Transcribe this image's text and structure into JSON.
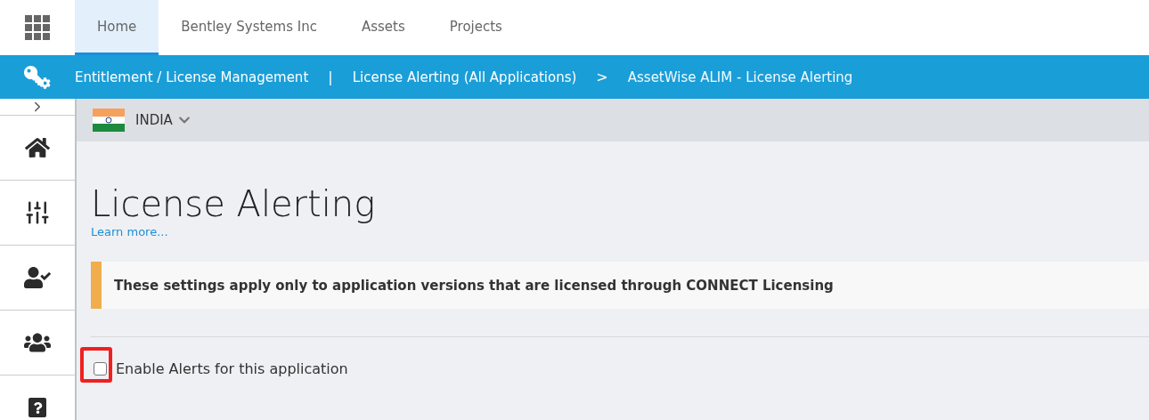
{
  "top_tabs": [
    {
      "label": "Home",
      "selected": true
    },
    {
      "label": "Bentley Systems Inc",
      "selected": false
    },
    {
      "label": "Assets",
      "selected": false
    },
    {
      "label": "Projects",
      "selected": false
    }
  ],
  "breadcrumb": [
    {
      "kind": "link",
      "label": "Entitlement / License Management"
    },
    {
      "kind": "separator",
      "label": "|"
    },
    {
      "kind": "link",
      "label": "License Alerting (All Applications)"
    },
    {
      "kind": "separator",
      "label": ">"
    },
    {
      "kind": "current",
      "label": "AssetWise ALIM - License Alerting"
    }
  ],
  "sidebar": {
    "expanded": false,
    "items": [
      {
        "kind": "home"
      },
      {
        "kind": "sliders"
      },
      {
        "kind": "user-check"
      },
      {
        "kind": "users"
      },
      {
        "kind": "help"
      }
    ]
  },
  "country": {
    "label": "INDIA"
  },
  "page": {
    "title": "License Alerting",
    "link": "Learn more...",
    "notice": "These settings apply only to application versions that are licensed through CONNECT Licensing",
    "enable_alerts": {
      "label": "Enable Alerts for this application",
      "checked": false,
      "highlighted": true
    }
  }
}
